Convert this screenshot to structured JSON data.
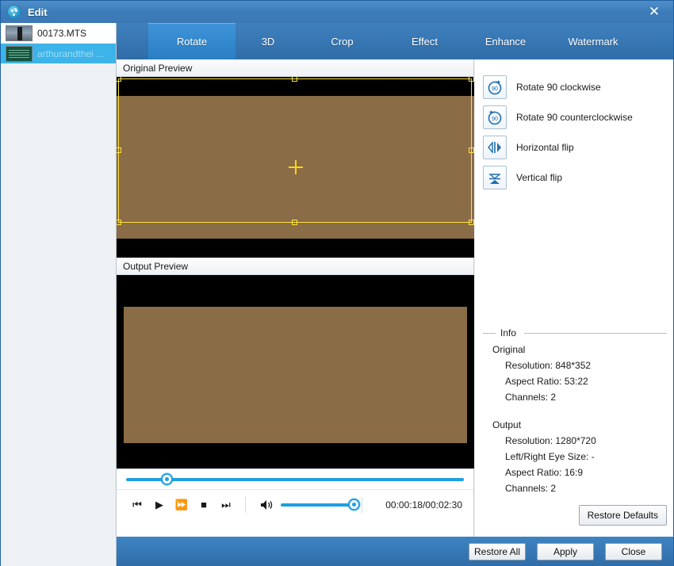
{
  "window": {
    "title": "Edit",
    "icon": "app-circle-icon",
    "close_label": "✕",
    "accent_color": "#3b78b6",
    "active_tab_color": "#2a7fc4",
    "slider_color": "#1e9fe0",
    "crop_color": "#ffe23a"
  },
  "sidebar": {
    "files": [
      {
        "name": "00173.MTS",
        "selected": false
      },
      {
        "name": "arthurandthei ...",
        "selected": true
      }
    ]
  },
  "tabs": [
    {
      "label": "Rotate",
      "active": true
    },
    {
      "label": "3D",
      "active": false
    },
    {
      "label": "Crop",
      "active": false
    },
    {
      "label": "Effect",
      "active": false
    },
    {
      "label": "Enhance",
      "active": false
    },
    {
      "label": "Watermark",
      "active": false
    }
  ],
  "preview": {
    "original_label": "Original Preview",
    "output_label": "Output Preview"
  },
  "transport": {
    "seek_percent": 12,
    "volume_percent": 100,
    "timecode": "00:00:18/00:02:30",
    "buttons": [
      {
        "name": "previous-frame-button",
        "glyph": "⏮"
      },
      {
        "name": "play-button",
        "glyph": "▶"
      },
      {
        "name": "fast-forward-button",
        "glyph": "⏩"
      },
      {
        "name": "stop-button",
        "glyph": "■"
      },
      {
        "name": "next-frame-button",
        "glyph": "⏭"
      }
    ],
    "volume_icon": "speaker-icon"
  },
  "rotate_options": [
    {
      "label": "Rotate 90 clockwise",
      "icon": "rotate-cw-icon",
      "badge": "90"
    },
    {
      "label": "Rotate 90 counterclockwise",
      "icon": "rotate-ccw-icon",
      "badge": "90"
    },
    {
      "label": "Horizontal flip",
      "icon": "flip-horizontal-icon",
      "badge": ""
    },
    {
      "label": "Vertical flip",
      "icon": "flip-vertical-icon",
      "badge": ""
    }
  ],
  "info": {
    "legend": "Info",
    "original_heading": "Original",
    "original_lines": [
      "Resolution: 848*352",
      "Aspect Ratio: 53:22",
      "Channels: 2"
    ],
    "output_heading": "Output",
    "output_lines": [
      "Resolution: 1280*720",
      "Left/Right Eye Size: -",
      "Aspect Ratio: 16:9",
      "Channels: 2"
    ]
  },
  "buttons": {
    "restore_defaults": "Restore Defaults",
    "restore_all": "Restore All",
    "apply": "Apply",
    "close": "Close"
  }
}
